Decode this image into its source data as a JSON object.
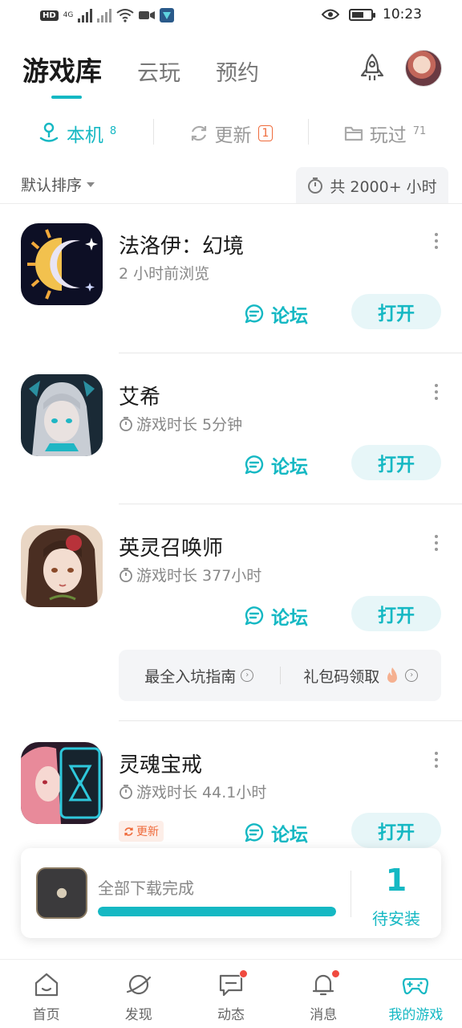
{
  "status_bar": {
    "time": "10:23",
    "network": "HD",
    "signal_label": "4G"
  },
  "header": {
    "tabs": [
      {
        "label": "游戏库"
      },
      {
        "label": "云玩"
      },
      {
        "label": "预约"
      }
    ]
  },
  "subtabs": [
    {
      "label": "本机",
      "count": "8",
      "icon": "joystick-icon"
    },
    {
      "label": "更新",
      "count": "1",
      "icon": "refresh-icon"
    },
    {
      "label": "玩过",
      "count": "71",
      "icon": "folder-icon"
    }
  ],
  "sort": {
    "label": "默认排序"
  },
  "total_time": {
    "label": "共 2000+ 小时"
  },
  "games": [
    {
      "name": "法洛伊：幻境",
      "sub": "2 小时前浏览",
      "forum": "论坛",
      "open": "打开"
    },
    {
      "name": "艾希",
      "sub": "游戏时长 5分钟",
      "forum": "论坛",
      "open": "打开"
    },
    {
      "name": "英灵召唤师",
      "sub": "游戏时长 377小时",
      "forum": "论坛",
      "open": "打开",
      "links": [
        {
          "label": "最全入坑指南"
        },
        {
          "label": "礼包码领取"
        }
      ]
    },
    {
      "name": "灵魂宝戒",
      "sub": "游戏时长 44.1小时",
      "forum": "论坛",
      "open": "打开",
      "tag": "更新"
    }
  ],
  "download": {
    "status": "全部下载完成",
    "progress": 1.0,
    "count": "1",
    "pending_label": "待安装"
  },
  "bottom_nav": [
    {
      "label": "首页",
      "icon": "home-icon"
    },
    {
      "label": "发现",
      "icon": "planet-icon"
    },
    {
      "label": "动态",
      "icon": "chat-icon"
    },
    {
      "label": "消息",
      "icon": "bell-icon"
    },
    {
      "label": "我的游戏",
      "icon": "gamepad-icon"
    }
  ],
  "colors": {
    "accent": "#15b8c3",
    "update": "#ef6b3b",
    "dot": "#f04a3f"
  }
}
